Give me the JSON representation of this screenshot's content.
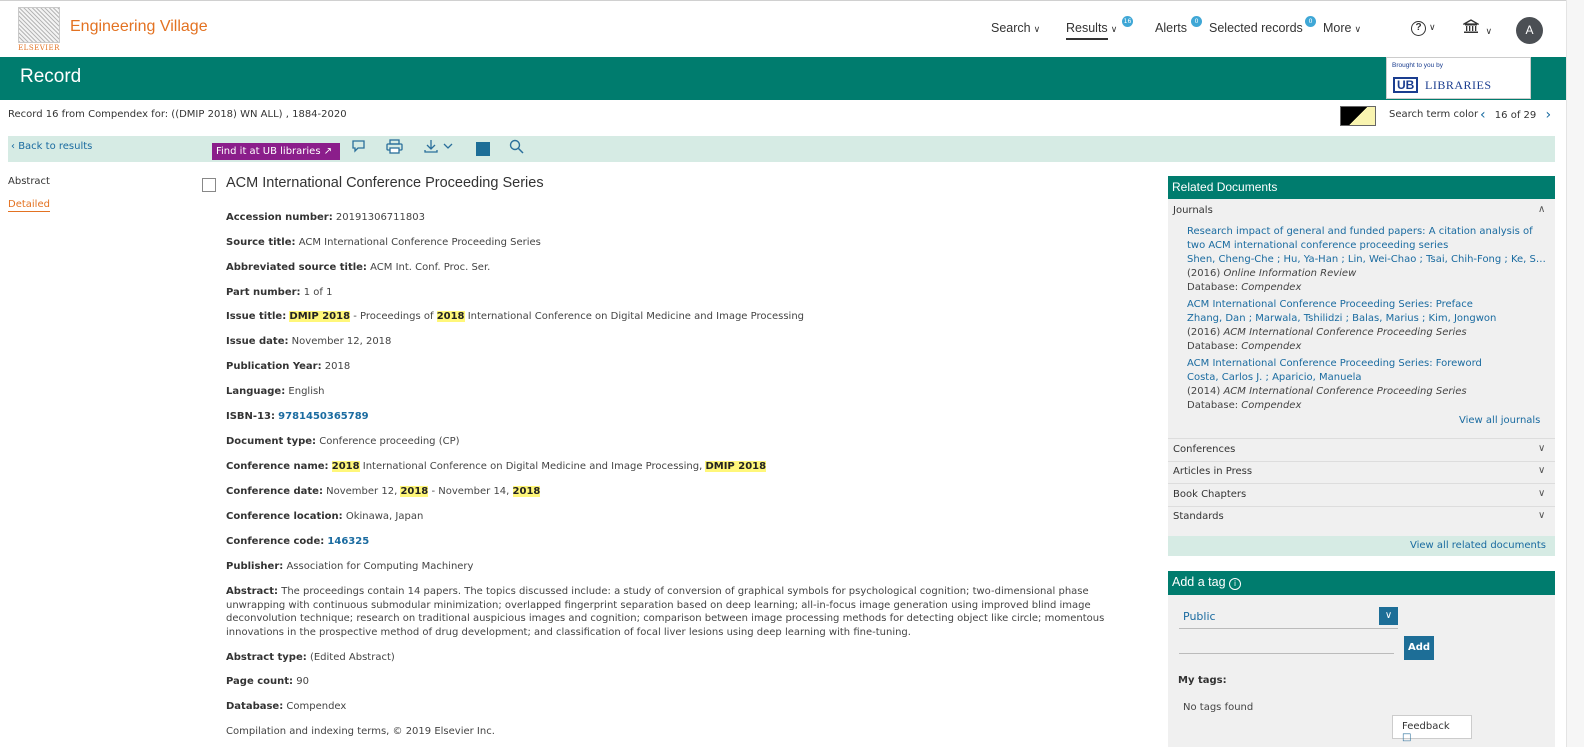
{
  "header": {
    "logo_text": "ELSEVIER",
    "brand": "Engineering Village",
    "nav": {
      "search": "Search",
      "results": "Results",
      "results_badge": "16",
      "alerts": "Alerts",
      "alerts_badge": "0",
      "selected": "Selected records",
      "selected_badge": "0",
      "more": "More"
    },
    "help_icon": "?",
    "avatar": "A"
  },
  "record_bar": {
    "title": "Record",
    "brought_by": "Brought to you by",
    "ub": "UB",
    "libraries": "LIBRARIES"
  },
  "record_info": {
    "text": "Record 16 from Compendex for: ((DMIP 2018) WN ALL) , 1884-2020",
    "search_term_color": "Search term color",
    "pager": "16 of 29"
  },
  "toolbar": {
    "back": "Back to results",
    "find": "Find it at UB libraries"
  },
  "left_nav": {
    "abstract": "Abstract",
    "detailed": "Detailed"
  },
  "record": {
    "title": "ACM International Conference Proceeding Series",
    "accession_label": "Accession number:",
    "accession": "20191306711803",
    "source_label": "Source title:",
    "source": "ACM International Conference Proceeding Series",
    "abbrev_label": "Abbreviated source title:",
    "abbrev": "ACM Int. Conf. Proc. Ser.",
    "part_label": "Part number:",
    "part": "1 of 1",
    "issue_label": "Issue title:",
    "issue_hl1": "DMIP 2018",
    "issue_mid": " - Proceedings of ",
    "issue_hl2": "2018",
    "issue_end": " International Conference on Digital Medicine and Image Processing",
    "issue_date_label": "Issue date:",
    "issue_date": "November 12, 2018",
    "pubyear_label": "Publication Year:",
    "pubyear": "2018",
    "language_label": "Language:",
    "language": "English",
    "isbn_label": "ISBN-13:",
    "isbn": "9781450365789",
    "doctype_label": "Document type:",
    "doctype": "Conference proceeding (CP)",
    "confname_label": "Conference name:",
    "confname_hl1": "2018",
    "confname_mid": " International Conference on Digital Medicine and Image Processing, ",
    "confname_hl2": "DMIP 2018",
    "confdate_label": "Conference date:",
    "confdate_a": "November 12, ",
    "confdate_hl1": "2018",
    "confdate_b": " - November 14, ",
    "confdate_hl2": "2018",
    "confloc_label": "Conference location:",
    "confloc": "Okinawa, Japan",
    "confcode_label": "Conference code:",
    "confcode": "146325",
    "publisher_label": "Publisher:",
    "publisher": "Association for Computing Machinery",
    "abstract_label": "Abstract:",
    "abstract": "The proceedings contain 14 papers. The topics discussed include: a study of conversion of graphical symbols for psychological cognition; two-dimensional phase unwrapping with continuous submodular minimization; overlapped fingerprint separation based on deep learning; all-in-focus image generation using improved blind image deconvolution technique; research on traditional auspicious images and cognition; comparison between image processing methods for detecting object like circle; momentous innovations in the prospective method of drug development; and classification of focal liver lesions using deep learning with fine-tuning.",
    "abstype_label": "Abstract type:",
    "abstype": "(Edited Abstract)",
    "pagecount_label": "Page count:",
    "pagecount": "90",
    "database_label": "Database:",
    "database": "Compendex",
    "copyright": "Compilation and indexing terms, © 2019 Elsevier Inc."
  },
  "related": {
    "header": "Related Documents",
    "journals": "Journals",
    "items": [
      {
        "title": "Research impact of general and funded papers: A citation analysis of two ACM international conference proceeding series",
        "authors": "Shen, Cheng-Che ; Hu, Ya-Han ; Lin, Wei-Chao ; Tsai, Chih-Fong ; Ke, Sh...",
        "year": "(2016)",
        "source": "Online Information Review",
        "db_label": "Database:",
        "db": "Compendex"
      },
      {
        "title": "ACM International Conference Proceeding Series: Preface",
        "authors": "Zhang, Dan ; Marwala, Tshilidzi ; Balas, Marius ; Kim, Jongwon",
        "year": "(2016)",
        "source": "ACM International Conference Proceeding Series",
        "db_label": "Database:",
        "db": "Compendex"
      },
      {
        "title": "ACM International Conference Proceeding Series: Foreword",
        "authors": "Costa, Carlos J. ; Aparicio, Manuela",
        "year": "(2014)",
        "source": "ACM International Conference Proceeding Series",
        "db_label": "Database:",
        "db": "Compendex"
      }
    ],
    "view_all_journals": "View all journals",
    "conferences": "Conferences",
    "articles_in_press": "Articles in Press",
    "book_chapters": "Book Chapters",
    "standards": "Standards",
    "view_all_related": "View all related documents"
  },
  "tags": {
    "header": "Add a tag",
    "visibility": "Public",
    "add": "Add",
    "my_tags": "My tags:",
    "no_tags": "No tags found"
  },
  "feedback": "Feedback"
}
